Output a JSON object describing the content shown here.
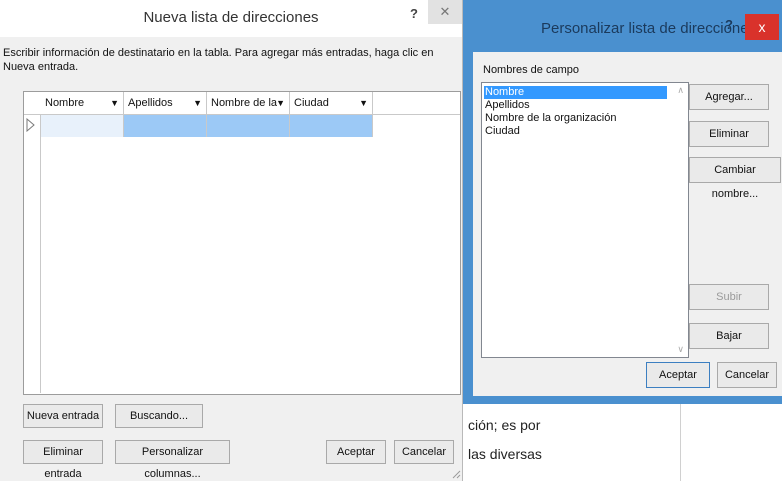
{
  "left_dialog": {
    "title": "Nueva lista de direcciones",
    "help": "?",
    "close": "✕",
    "instructions": "Escribir información de destinatario en la tabla. Para agregar más entradas, haga clic en Nueva entrada.",
    "columns": [
      "Nombre",
      "Apellidos",
      "Nombre de la ...",
      "Ciudad"
    ],
    "buttons": {
      "new_entry": "Nueva entrada",
      "search": "Buscando...",
      "delete_entry": "Eliminar entrada",
      "customize_columns": "Personalizar columnas...",
      "ok": "Aceptar",
      "cancel": "Cancelar"
    }
  },
  "right_dialog": {
    "title": "Personalizar lista de direcciones",
    "help": "?",
    "close": "x",
    "fields_label": "Nombres de campo",
    "fields": [
      "Nombre",
      "Apellidos",
      "Nombre de la organización",
      "Ciudad"
    ],
    "selected_field": "Nombre",
    "buttons": {
      "add": "Agregar...",
      "delete": "Eliminar",
      "rename": "Cambiar nombre...",
      "up": "Subir",
      "down": "Bajar",
      "ok": "Aceptar",
      "cancel": "Cancelar"
    }
  },
  "document": {
    "line1": "ción; es por",
    "line2": "las diversas"
  },
  "colors": {
    "accent_blue": "#4a90cf",
    "selection_blue": "#3399ff",
    "cell_selection": "#9cc9f6",
    "close_red": "#d9322b"
  }
}
